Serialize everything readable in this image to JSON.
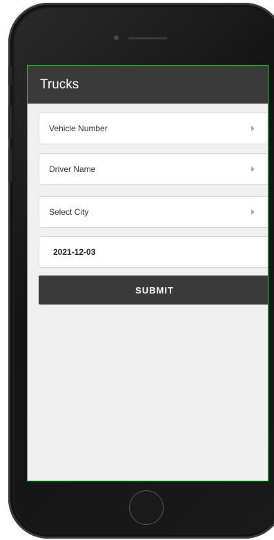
{
  "app": {
    "title": "Trucks"
  },
  "form": {
    "vehicle_number_label": "Vehicle Number",
    "driver_name_label": "Driver Name",
    "city_label": "Select City",
    "date_value": "2021-12-03",
    "submit_label": "SUBMIT"
  },
  "icons": {
    "dropdown": "chevron-right-icon"
  },
  "colors": {
    "app_bar": "#3a3a3a",
    "screen_background": "#f0f0f0",
    "screen_border": "#4caf50",
    "submit_button": "#3a3a3a"
  }
}
